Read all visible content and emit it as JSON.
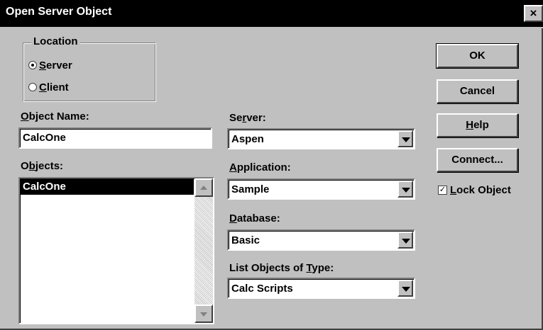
{
  "dialog": {
    "title": "Open Server Object",
    "close_glyph": "×"
  },
  "location": {
    "legend": "Location",
    "options": [
      {
        "prefix": "",
        "key": "S",
        "rest": "erver",
        "checked": true
      },
      {
        "prefix": "",
        "key": "C",
        "rest": "lient",
        "checked": false
      }
    ]
  },
  "object_name": {
    "label_key": "O",
    "label_rest": "bject Name:",
    "value": "CalcOne"
  },
  "objects": {
    "label_prefix": "O",
    "label_key": "b",
    "label_rest": "jects:",
    "items": [
      "CalcOne"
    ],
    "selected_index": 0
  },
  "server": {
    "label_prefix": "Se",
    "label_key": "r",
    "label_rest": "ver:",
    "value": "Aspen"
  },
  "application": {
    "label_key": "A",
    "label_rest": "pplication:",
    "value": "Sample"
  },
  "database": {
    "label_key": "D",
    "label_rest": "atabase:",
    "value": "Basic"
  },
  "object_type": {
    "label_prefix": "List Objects of ",
    "label_key": "T",
    "label_rest": "ype:",
    "value": "Calc Scripts"
  },
  "buttons": {
    "ok": "OK",
    "cancel": "Cancel",
    "help_key": "H",
    "help_rest": "elp",
    "connect": "Connect..."
  },
  "lock": {
    "label_key": "L",
    "label_rest": "ock Object",
    "checked": true,
    "check_glyph": "✓"
  },
  "icons": {
    "close": "close-icon",
    "combo_arrow": "chevron-down-icon",
    "scroll_up": "arrow-up-icon",
    "scroll_down": "arrow-down-icon"
  }
}
